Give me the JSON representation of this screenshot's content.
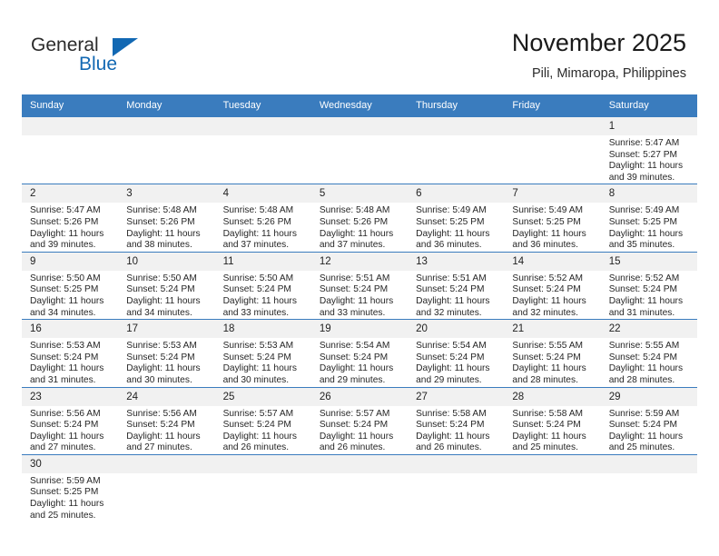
{
  "brand": {
    "line1": "General",
    "line2": "Blue",
    "triangle_icon": "triangle-icon",
    "accent_color": "#1268b3"
  },
  "header": {
    "title": "November 2025",
    "subtitle": "Pili, Mimaropa, Philippines"
  },
  "colors": {
    "header_blue": "#3a7cbe",
    "daynum_bg": "#f1f1f1",
    "text": "#262626"
  },
  "weekdays": [
    "Sunday",
    "Monday",
    "Tuesday",
    "Wednesday",
    "Thursday",
    "Friday",
    "Saturday"
  ],
  "labels": {
    "sunrise_prefix": "Sunrise:",
    "sunset_prefix": "Sunset:",
    "daylight_prefix": "Daylight:"
  },
  "weeks": [
    [
      {
        "day": "",
        "blank": true
      },
      {
        "day": "",
        "blank": true
      },
      {
        "day": "",
        "blank": true
      },
      {
        "day": "",
        "blank": true
      },
      {
        "day": "",
        "blank": true
      },
      {
        "day": "",
        "blank": true
      },
      {
        "day": "1",
        "sunrise": "Sunrise: 5:47 AM",
        "sunset": "Sunset: 5:27 PM",
        "daylight1": "Daylight: 11 hours",
        "daylight2": "and 39 minutes."
      }
    ],
    [
      {
        "day": "2",
        "sunrise": "Sunrise: 5:47 AM",
        "sunset": "Sunset: 5:26 PM",
        "daylight1": "Daylight: 11 hours",
        "daylight2": "and 39 minutes."
      },
      {
        "day": "3",
        "sunrise": "Sunrise: 5:48 AM",
        "sunset": "Sunset: 5:26 PM",
        "daylight1": "Daylight: 11 hours",
        "daylight2": "and 38 minutes."
      },
      {
        "day": "4",
        "sunrise": "Sunrise: 5:48 AM",
        "sunset": "Sunset: 5:26 PM",
        "daylight1": "Daylight: 11 hours",
        "daylight2": "and 37 minutes."
      },
      {
        "day": "5",
        "sunrise": "Sunrise: 5:48 AM",
        "sunset": "Sunset: 5:26 PM",
        "daylight1": "Daylight: 11 hours",
        "daylight2": "and 37 minutes."
      },
      {
        "day": "6",
        "sunrise": "Sunrise: 5:49 AM",
        "sunset": "Sunset: 5:25 PM",
        "daylight1": "Daylight: 11 hours",
        "daylight2": "and 36 minutes."
      },
      {
        "day": "7",
        "sunrise": "Sunrise: 5:49 AM",
        "sunset": "Sunset: 5:25 PM",
        "daylight1": "Daylight: 11 hours",
        "daylight2": "and 36 minutes."
      },
      {
        "day": "8",
        "sunrise": "Sunrise: 5:49 AM",
        "sunset": "Sunset: 5:25 PM",
        "daylight1": "Daylight: 11 hours",
        "daylight2": "and 35 minutes."
      }
    ],
    [
      {
        "day": "9",
        "sunrise": "Sunrise: 5:50 AM",
        "sunset": "Sunset: 5:25 PM",
        "daylight1": "Daylight: 11 hours",
        "daylight2": "and 34 minutes."
      },
      {
        "day": "10",
        "sunrise": "Sunrise: 5:50 AM",
        "sunset": "Sunset: 5:24 PM",
        "daylight1": "Daylight: 11 hours",
        "daylight2": "and 34 minutes."
      },
      {
        "day": "11",
        "sunrise": "Sunrise: 5:50 AM",
        "sunset": "Sunset: 5:24 PM",
        "daylight1": "Daylight: 11 hours",
        "daylight2": "and 33 minutes."
      },
      {
        "day": "12",
        "sunrise": "Sunrise: 5:51 AM",
        "sunset": "Sunset: 5:24 PM",
        "daylight1": "Daylight: 11 hours",
        "daylight2": "and 33 minutes."
      },
      {
        "day": "13",
        "sunrise": "Sunrise: 5:51 AM",
        "sunset": "Sunset: 5:24 PM",
        "daylight1": "Daylight: 11 hours",
        "daylight2": "and 32 minutes."
      },
      {
        "day": "14",
        "sunrise": "Sunrise: 5:52 AM",
        "sunset": "Sunset: 5:24 PM",
        "daylight1": "Daylight: 11 hours",
        "daylight2": "and 32 minutes."
      },
      {
        "day": "15",
        "sunrise": "Sunrise: 5:52 AM",
        "sunset": "Sunset: 5:24 PM",
        "daylight1": "Daylight: 11 hours",
        "daylight2": "and 31 minutes."
      }
    ],
    [
      {
        "day": "16",
        "sunrise": "Sunrise: 5:53 AM",
        "sunset": "Sunset: 5:24 PM",
        "daylight1": "Daylight: 11 hours",
        "daylight2": "and 31 minutes."
      },
      {
        "day": "17",
        "sunrise": "Sunrise: 5:53 AM",
        "sunset": "Sunset: 5:24 PM",
        "daylight1": "Daylight: 11 hours",
        "daylight2": "and 30 minutes."
      },
      {
        "day": "18",
        "sunrise": "Sunrise: 5:53 AM",
        "sunset": "Sunset: 5:24 PM",
        "daylight1": "Daylight: 11 hours",
        "daylight2": "and 30 minutes."
      },
      {
        "day": "19",
        "sunrise": "Sunrise: 5:54 AM",
        "sunset": "Sunset: 5:24 PM",
        "daylight1": "Daylight: 11 hours",
        "daylight2": "and 29 minutes."
      },
      {
        "day": "20",
        "sunrise": "Sunrise: 5:54 AM",
        "sunset": "Sunset: 5:24 PM",
        "daylight1": "Daylight: 11 hours",
        "daylight2": "and 29 minutes."
      },
      {
        "day": "21",
        "sunrise": "Sunrise: 5:55 AM",
        "sunset": "Sunset: 5:24 PM",
        "daylight1": "Daylight: 11 hours",
        "daylight2": "and 28 minutes."
      },
      {
        "day": "22",
        "sunrise": "Sunrise: 5:55 AM",
        "sunset": "Sunset: 5:24 PM",
        "daylight1": "Daylight: 11 hours",
        "daylight2": "and 28 minutes."
      }
    ],
    [
      {
        "day": "23",
        "sunrise": "Sunrise: 5:56 AM",
        "sunset": "Sunset: 5:24 PM",
        "daylight1": "Daylight: 11 hours",
        "daylight2": "and 27 minutes."
      },
      {
        "day": "24",
        "sunrise": "Sunrise: 5:56 AM",
        "sunset": "Sunset: 5:24 PM",
        "daylight1": "Daylight: 11 hours",
        "daylight2": "and 27 minutes."
      },
      {
        "day": "25",
        "sunrise": "Sunrise: 5:57 AM",
        "sunset": "Sunset: 5:24 PM",
        "daylight1": "Daylight: 11 hours",
        "daylight2": "and 26 minutes."
      },
      {
        "day": "26",
        "sunrise": "Sunrise: 5:57 AM",
        "sunset": "Sunset: 5:24 PM",
        "daylight1": "Daylight: 11 hours",
        "daylight2": "and 26 minutes."
      },
      {
        "day": "27",
        "sunrise": "Sunrise: 5:58 AM",
        "sunset": "Sunset: 5:24 PM",
        "daylight1": "Daylight: 11 hours",
        "daylight2": "and 26 minutes."
      },
      {
        "day": "28",
        "sunrise": "Sunrise: 5:58 AM",
        "sunset": "Sunset: 5:24 PM",
        "daylight1": "Daylight: 11 hours",
        "daylight2": "and 25 minutes."
      },
      {
        "day": "29",
        "sunrise": "Sunrise: 5:59 AM",
        "sunset": "Sunset: 5:24 PM",
        "daylight1": "Daylight: 11 hours",
        "daylight2": "and 25 minutes."
      }
    ],
    [
      {
        "day": "30",
        "sunrise": "Sunrise: 5:59 AM",
        "sunset": "Sunset: 5:25 PM",
        "daylight1": "Daylight: 11 hours",
        "daylight2": "and 25 minutes."
      },
      {
        "day": "",
        "blank": true
      },
      {
        "day": "",
        "blank": true
      },
      {
        "day": "",
        "blank": true
      },
      {
        "day": "",
        "blank": true
      },
      {
        "day": "",
        "blank": true
      },
      {
        "day": "",
        "blank": true
      }
    ]
  ]
}
